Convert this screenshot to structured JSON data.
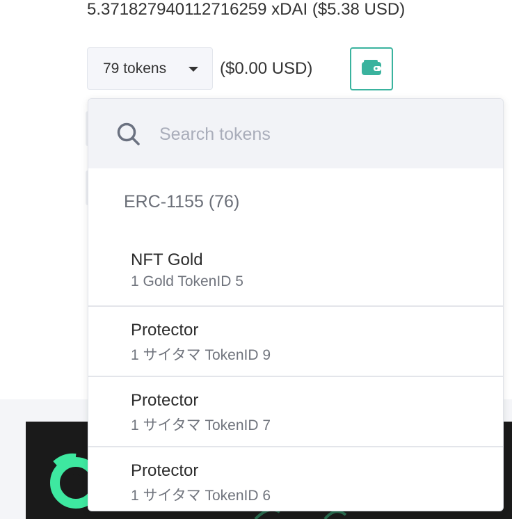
{
  "balance": "5.371827940112716259 xDAI ($5.38 USD)",
  "tokens_button": {
    "label": "79 tokens"
  },
  "tokens_usd": "($0.00 USD)",
  "wallet_button": {
    "icon": "wallet-icon",
    "color": "#3ab39e"
  },
  "dropdown": {
    "search": {
      "placeholder": "Search tokens",
      "icon": "search-icon"
    },
    "group": {
      "title": "ERC-1155 (76)"
    },
    "items": [
      {
        "name": "NFT Gold",
        "sub": "1 Gold TokenID 5"
      },
      {
        "name": "Protector",
        "sub": "1 サイタマ TokenID 9"
      },
      {
        "name": "Protector",
        "sub": "1 サイタマ TokenID 7"
      },
      {
        "name": "Protector",
        "sub": "1 サイタマ TokenID 6"
      }
    ]
  }
}
